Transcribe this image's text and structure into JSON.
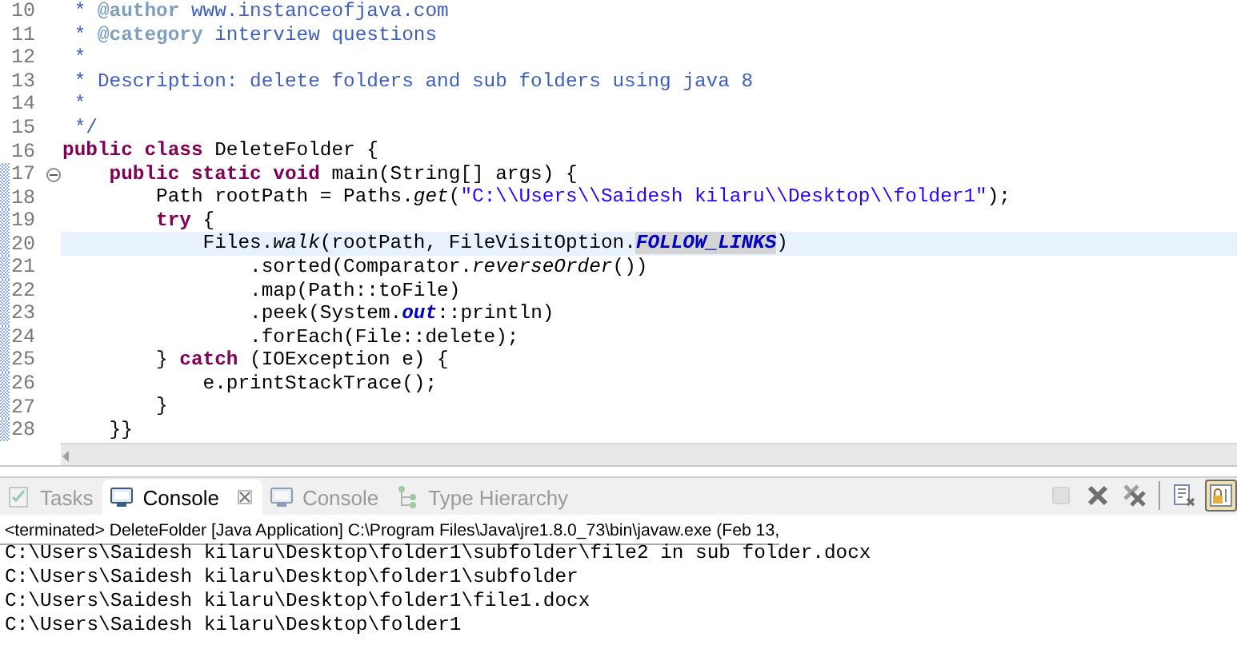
{
  "editor": {
    "lines": [
      {
        "number": "10",
        "changed": false,
        "current": false,
        "segments": [
          {
            "kind": "comment",
            "text": " * "
          },
          {
            "kind": "comment_tag",
            "text": "@author"
          },
          {
            "kind": "comment",
            "text": " www.instanceofjava.com"
          }
        ]
      },
      {
        "number": "11",
        "changed": false,
        "current": false,
        "segments": [
          {
            "kind": "comment",
            "text": " * "
          },
          {
            "kind": "comment_tag",
            "text": "@category"
          },
          {
            "kind": "comment",
            "text": " interview questions"
          }
        ]
      },
      {
        "number": "12",
        "changed": false,
        "current": false,
        "segments": [
          {
            "kind": "comment",
            "text": " *"
          }
        ]
      },
      {
        "number": "13",
        "changed": false,
        "current": false,
        "segments": [
          {
            "kind": "comment",
            "text": " * Description: delete folders and sub folders using java 8"
          }
        ]
      },
      {
        "number": "14",
        "changed": false,
        "current": false,
        "segments": [
          {
            "kind": "comment",
            "text": " *"
          }
        ]
      },
      {
        "number": "15",
        "changed": false,
        "current": false,
        "segments": [
          {
            "kind": "comment",
            "text": " */"
          }
        ]
      },
      {
        "number": "16",
        "changed": false,
        "current": false,
        "segments": [
          {
            "kind": "keyword",
            "text": "public class"
          },
          {
            "kind": "plain",
            "text": " DeleteFolder {"
          }
        ]
      },
      {
        "number": "17",
        "changed": true,
        "current": false,
        "expanded": true,
        "segments": [
          {
            "kind": "keyword",
            "text": "    public static void"
          },
          {
            "kind": "plain",
            "text": " main(String[] args) {"
          }
        ]
      },
      {
        "number": "18",
        "changed": true,
        "current": false,
        "segments": [
          {
            "kind": "plain",
            "text": "        Path rootPath = Paths."
          },
          {
            "kind": "static_method",
            "text": "get"
          },
          {
            "kind": "plain",
            "text": "("
          },
          {
            "kind": "string",
            "text": "\"C:\\\\Users\\\\Saidesh kilaru\\\\Desktop\\\\folder1\""
          },
          {
            "kind": "plain",
            "text": ");"
          }
        ]
      },
      {
        "number": "19",
        "changed": true,
        "current": false,
        "segments": [
          {
            "kind": "keyword",
            "text": "        try"
          },
          {
            "kind": "plain",
            "text": " {"
          }
        ]
      },
      {
        "number": "20",
        "changed": true,
        "current": true,
        "segments": [
          {
            "kind": "plain",
            "text": "            Files."
          },
          {
            "kind": "static_method",
            "text": "walk"
          },
          {
            "kind": "plain",
            "text": "(rootPath, FileVisitOption."
          },
          {
            "kind": "static_field_marked",
            "text": "FOLLOW_LINKS"
          },
          {
            "kind": "plain",
            "text": ")"
          }
        ]
      },
      {
        "number": "21",
        "changed": true,
        "current": false,
        "segments": [
          {
            "kind": "plain",
            "text": "                .sorted(Comparator."
          },
          {
            "kind": "static_method",
            "text": "reverseOrder"
          },
          {
            "kind": "plain",
            "text": "())"
          }
        ]
      },
      {
        "number": "22",
        "changed": true,
        "current": false,
        "segments": [
          {
            "kind": "plain",
            "text": "                .map(Path::toFile)"
          }
        ]
      },
      {
        "number": "23",
        "changed": true,
        "current": false,
        "segments": [
          {
            "kind": "plain",
            "text": "                .peek(System."
          },
          {
            "kind": "static_field",
            "text": "out"
          },
          {
            "kind": "plain",
            "text": "::println)"
          }
        ]
      },
      {
        "number": "24",
        "changed": true,
        "current": false,
        "segments": [
          {
            "kind": "plain",
            "text": "                .forEach(File::delete);"
          }
        ]
      },
      {
        "number": "25",
        "changed": true,
        "current": false,
        "segments": [
          {
            "kind": "plain",
            "text": "        } "
          },
          {
            "kind": "keyword",
            "text": "catch"
          },
          {
            "kind": "plain",
            "text": " (IOException e) {"
          }
        ]
      },
      {
        "number": "26",
        "changed": true,
        "current": false,
        "segments": [
          {
            "kind": "plain",
            "text": "            e.printStackTrace();"
          }
        ]
      },
      {
        "number": "27",
        "changed": true,
        "current": false,
        "segments": [
          {
            "kind": "plain",
            "text": "        }"
          }
        ]
      },
      {
        "number": "28",
        "changed": true,
        "current": false,
        "segments": [
          {
            "kind": "plain",
            "text": "    }}"
          }
        ]
      }
    ]
  },
  "console": {
    "tabs": [
      {
        "kind": "tasks",
        "label": "Tasks",
        "selected": false,
        "closable": false
      },
      {
        "kind": "console",
        "label": "Console",
        "selected": true,
        "closable": true
      },
      {
        "kind": "console",
        "label": "Console",
        "selected": false,
        "closable": false
      },
      {
        "kind": "hierarchy",
        "label": "Type Hierarchy",
        "selected": false,
        "closable": false
      }
    ],
    "toolbar": [
      {
        "kind": "terminate",
        "disabled": true,
        "pressed": false
      },
      {
        "kind": "remove",
        "disabled": false,
        "pressed": false
      },
      {
        "kind": "remove_all",
        "disabled": false,
        "pressed": false
      },
      {
        "kind": "clear",
        "disabled": false,
        "pressed": false
      },
      {
        "kind": "scroll_lock",
        "disabled": false,
        "pressed": true
      }
    ],
    "header": "<terminated> DeleteFolder [Java Application] C:\\Program Files\\Java\\jre1.8.0_73\\bin\\javaw.exe (Feb 13,",
    "output": [
      "C:\\Users\\Saidesh kilaru\\Desktop\\folder1\\subfolder\\file2 in sub folder.docx",
      "C:\\Users\\Saidesh kilaru\\Desktop\\folder1\\subfolder",
      "C:\\Users\\Saidesh kilaru\\Desktop\\folder1\\file1.docx",
      "C:\\Users\\Saidesh kilaru\\Desktop\\folder1"
    ]
  }
}
